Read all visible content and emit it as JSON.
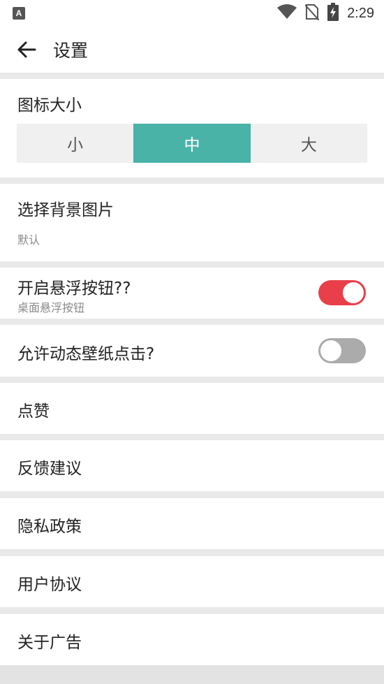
{
  "status_bar": {
    "app_badge": "A",
    "time": "2:29"
  },
  "header": {
    "title": "设置"
  },
  "icon_size": {
    "title": "图标大小",
    "options": [
      "小",
      "中",
      "大"
    ],
    "selected": "中",
    "accent_color": "#4ab3a8"
  },
  "background": {
    "title": "选择背景图片",
    "value": "默认"
  },
  "floating_button": {
    "title": "开启悬浮按钮??",
    "subtitle": "桌面悬浮按钮",
    "enabled": true,
    "on_color": "#e83f4b"
  },
  "live_wallpaper": {
    "title": "允许动态壁纸点击?",
    "enabled": false,
    "off_color": "#ababab"
  },
  "menu": {
    "like": "点赞",
    "feedback": "反馈建议",
    "privacy": "隐私政策",
    "agreement": "用户协议",
    "about_ads": "关于广告"
  }
}
